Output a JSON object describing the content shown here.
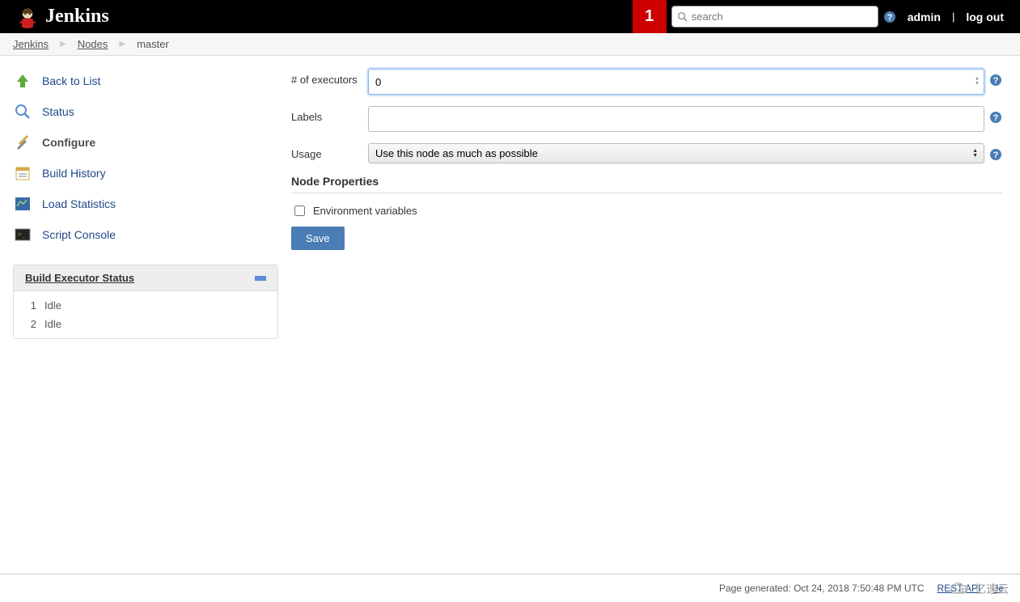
{
  "header": {
    "brand": "Jenkins",
    "notification_count": "1",
    "search_placeholder": "search",
    "user": "admin",
    "logout_label": "log out"
  },
  "breadcrumb": {
    "items": [
      "Jenkins",
      "Nodes",
      "master"
    ]
  },
  "sidebar": {
    "links": [
      {
        "label": "Back to List"
      },
      {
        "label": "Status"
      },
      {
        "label": "Configure"
      },
      {
        "label": "Build History"
      },
      {
        "label": "Load Statistics"
      },
      {
        "label": "Script Console"
      }
    ],
    "panel_title": "Build Executor Status",
    "executors": [
      {
        "num": "1",
        "status": "Idle"
      },
      {
        "num": "2",
        "status": "Idle"
      }
    ]
  },
  "form": {
    "executors_label": "# of executors",
    "executors_value": "0",
    "labels_label": "Labels",
    "labels_value": "",
    "usage_label": "Usage",
    "usage_value": "Use this node as much as possible",
    "section_title": "Node Properties",
    "env_vars_label": "Environment variables",
    "save_label": "Save"
  },
  "footer": {
    "generated": "Page generated: Oct 24, 2018 7:50:48 PM UTC",
    "rest_api": "REST API",
    "jenkins_link": "Je"
  },
  "watermark": "亿速云"
}
